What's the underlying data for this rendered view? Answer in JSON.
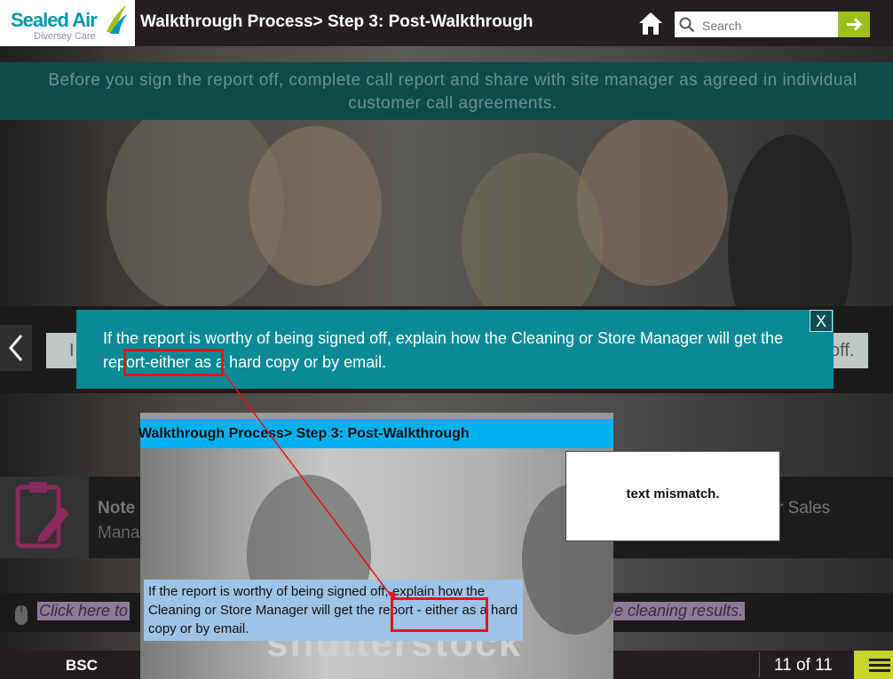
{
  "header": {
    "logo_main": "Sealed Air",
    "logo_sub": "Diversey Care",
    "title": "Walkthrough Process> Step 3: Post-Walkthrough",
    "search_placeholder": "Search"
  },
  "intro": {
    "text": "Before you sign the report off, complete call report and share with site manager as agreed in individual customer call agreements."
  },
  "behind_field": {
    "left_fragment": "I",
    "right_fragment": "off."
  },
  "popup": {
    "text_before": "If the report is worthy of being signed off, explain how the Cleaning or Store Manager will get the ",
    "highlight": "report-either",
    "text_after": " as a hard copy or by email.",
    "close_label": "X"
  },
  "note": {
    "title": "Note",
    "subtitle": "Mana",
    "right_fragment": "r Sales"
  },
  "click_row": {
    "left": "Click here to",
    "right": "e cleaning results."
  },
  "reference": {
    "title": "Walkthrough Process> Step 3: Post-Walkthrough",
    "text_before": "If the report is worthy of being signed off, explain how the Cleaning or Store Manager will get the ",
    "highlight": "report - either",
    "text_after": " as a hard copy or by email.",
    "watermark": "shutterstock"
  },
  "comment": {
    "text": "text mismatch."
  },
  "footer": {
    "label": "BSC",
    "page_counter": "11 of 11"
  },
  "colors": {
    "teal_popup": "#0b8a96",
    "highlight_red": "#e3141a",
    "search_green": "#9cbf1e",
    "menu_lime": "#c5d52a",
    "ref_blue": "#00b0f0"
  }
}
